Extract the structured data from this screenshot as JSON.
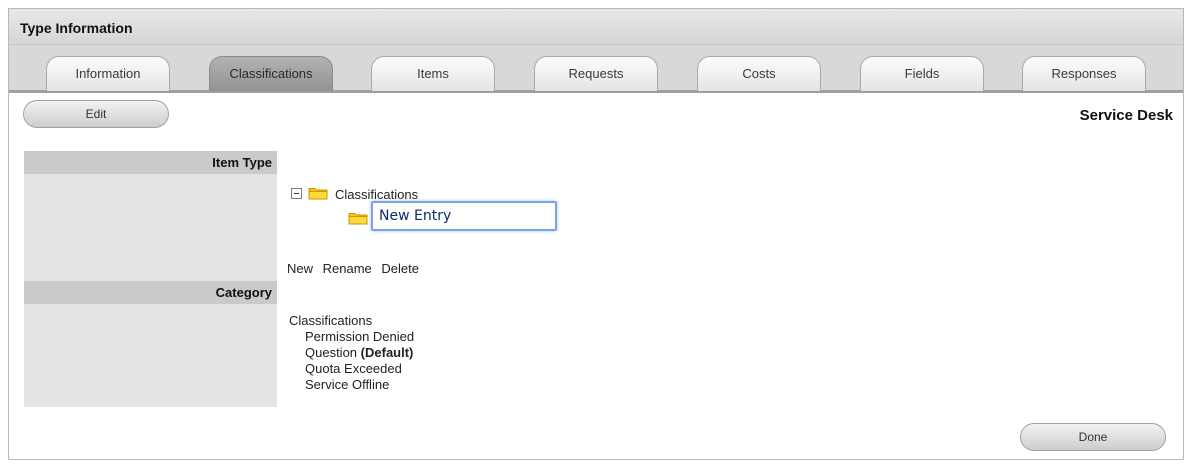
{
  "window": {
    "title": "Type Information"
  },
  "tabs": [
    {
      "label": "Information",
      "active": false
    },
    {
      "label": "Classifications",
      "active": true
    },
    {
      "label": "Items",
      "active": false
    },
    {
      "label": "Requests",
      "active": false
    },
    {
      "label": "Costs",
      "active": false
    },
    {
      "label": "Fields",
      "active": false
    },
    {
      "label": "Responses",
      "active": false
    }
  ],
  "toolbar": {
    "edit_label": "Edit",
    "section_title": "Service Desk"
  },
  "labels": {
    "item_type": "Item Type",
    "category": "Category"
  },
  "tree": {
    "root_label": "Classifications",
    "new_entry_value": "New Entry",
    "actions": [
      "New",
      "Rename",
      "Delete"
    ]
  },
  "category_list": {
    "root": "Classifications",
    "items": [
      {
        "label": "Permission Denied",
        "suffix": ""
      },
      {
        "label": "Question",
        "suffix": "(Default)"
      },
      {
        "label": "Quota Exceeded",
        "suffix": ""
      },
      {
        "label": "Service Offline",
        "suffix": ""
      }
    ]
  },
  "footer": {
    "done_label": "Done"
  },
  "icons": {
    "collapse": "minus-icon",
    "folder": "folder-icon"
  },
  "colors": {
    "active_tab": "#a0a0a0",
    "label_bar": "#cacaca",
    "label_fill": "#e4e4e4",
    "folder": "#f5c200",
    "input_border": "#7fa6d9"
  }
}
